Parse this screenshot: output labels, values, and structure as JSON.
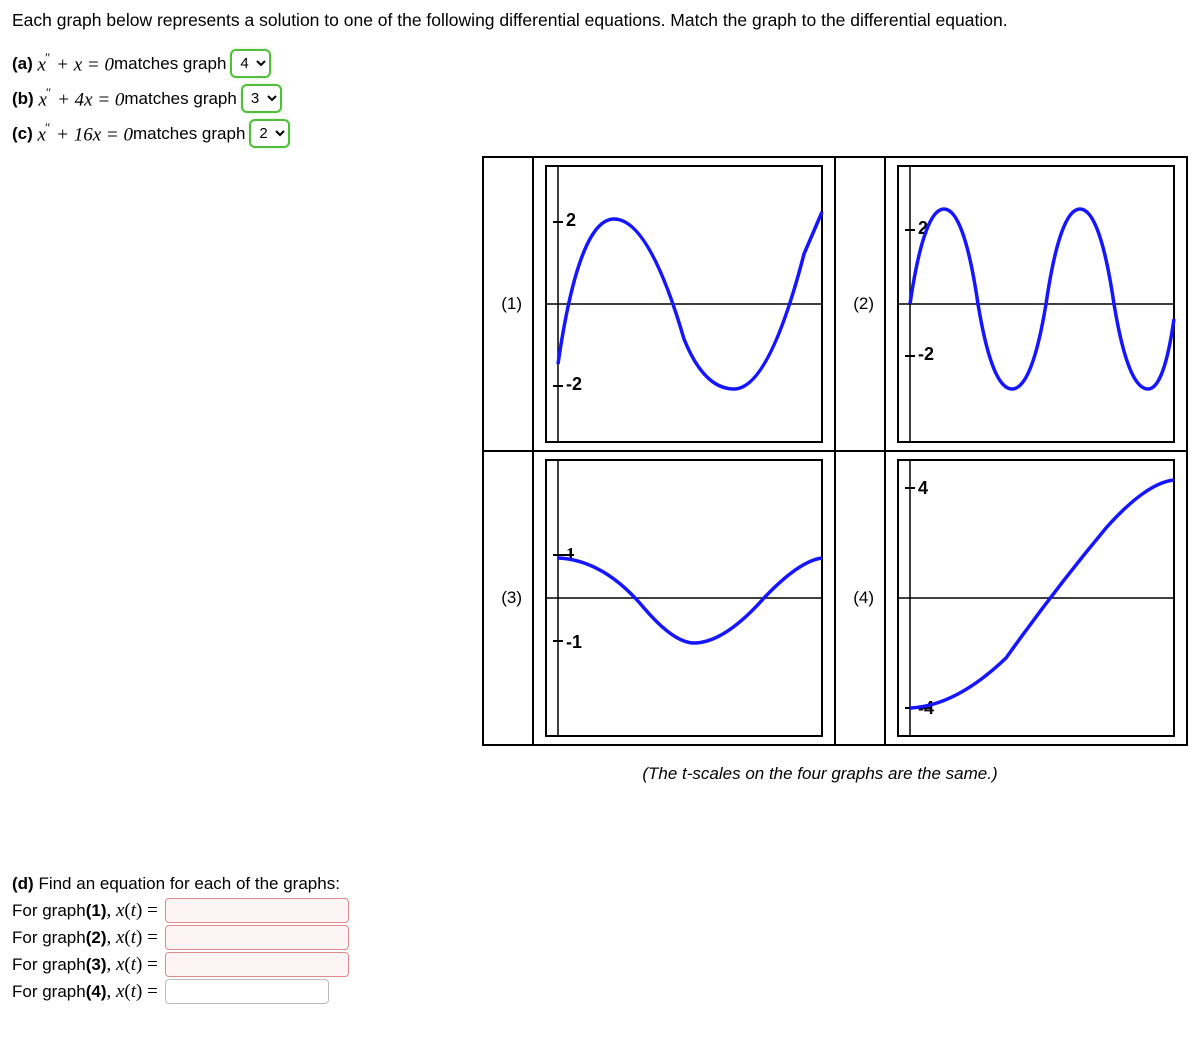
{
  "intro": "Each graph below represents a solution to one of the following differential equations. Match the graph to the differential equation.",
  "parts": {
    "a": {
      "label": "(a)",
      "eq_pre": "x",
      "eq_mid": " + x = 0",
      "tail": " matches graph",
      "value": "4"
    },
    "b": {
      "label": "(b)",
      "eq_pre": "x",
      "eq_mid": " + 4x = 0",
      "tail": " matches graph",
      "value": "3"
    },
    "c": {
      "label": "(c)",
      "eq_pre": "x",
      "eq_mid": " + 16x = 0",
      "tail": " matches graph",
      "value": "2"
    }
  },
  "select_options": [
    "1",
    "2",
    "3",
    "4"
  ],
  "graph_labels": {
    "g1": "(1)",
    "g2": "(2)",
    "g3": "(3)",
    "g4": "(4)"
  },
  "ticks": {
    "g1_top": "2",
    "g1_bot": "-2",
    "g2_top": "2",
    "g2_bot": "-2",
    "g3_top": "1",
    "g3_bot": "-1",
    "g4_top": "4",
    "g4_bot": "-4"
  },
  "scale_note": "(The t-scales on the four graphs are the same.)",
  "partd": {
    "title_label": "(d)",
    "title_text": " Find an equation for each of the graphs:",
    "rows": {
      "r1": {
        "pre": "For graph ",
        "bold": "(1)",
        "mid": ", x(t) = "
      },
      "r2": {
        "pre": "For graph ",
        "bold": "(2)",
        "mid": ", x(t) = "
      },
      "r3": {
        "pre": "For graph ",
        "bold": "(3)",
        "mid": ", x(t) = "
      },
      "r4": {
        "pre": "For graph ",
        "bold": "(4)",
        "mid": ", x(t) = "
      }
    }
  },
  "chart_data": [
    {
      "id": 1,
      "type": "line",
      "title": "",
      "ylim": [
        -3,
        3
      ],
      "yticks": [
        2,
        -2
      ],
      "series": [
        {
          "name": "x(t)",
          "expr": "2*sin(2t - 0.5)",
          "approx": true
        }
      ]
    },
    {
      "id": 2,
      "type": "line",
      "title": "",
      "ylim": [
        -3,
        3
      ],
      "yticks": [
        2,
        -2
      ],
      "series": [
        {
          "name": "x(t)",
          "expr": "2.5*sin(4t)",
          "approx": true
        }
      ]
    },
    {
      "id": 3,
      "type": "line",
      "title": "",
      "ylim": [
        -1.5,
        1.5
      ],
      "yticks": [
        1,
        -1
      ],
      "series": [
        {
          "name": "x(t)",
          "expr": "cos(2t)",
          "approx": true,
          "note": "starts near 1, dips to about -1, returns near 1"
        }
      ]
    },
    {
      "id": 4,
      "type": "line",
      "title": "",
      "ylim": [
        -5,
        5
      ],
      "yticks": [
        4,
        -4
      ],
      "series": [
        {
          "name": "x(t)",
          "expr": "-4*cos(t)",
          "approx": true,
          "note": "monotone S-shape from -4 to about 4"
        }
      ]
    }
  ]
}
